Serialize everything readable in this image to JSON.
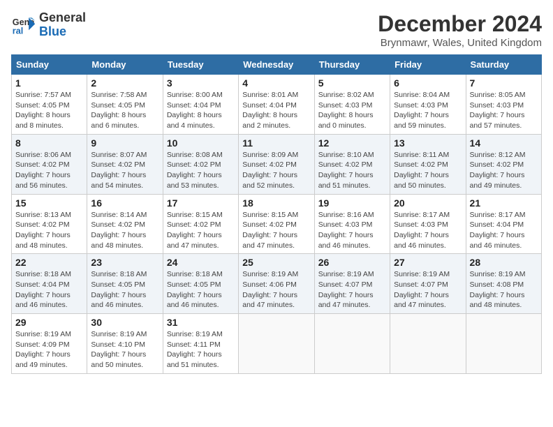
{
  "header": {
    "logo_line1": "General",
    "logo_line2": "Blue",
    "month_title": "December 2024",
    "location": "Brynmawr, Wales, United Kingdom"
  },
  "weekdays": [
    "Sunday",
    "Monday",
    "Tuesday",
    "Wednesday",
    "Thursday",
    "Friday",
    "Saturday"
  ],
  "weeks": [
    [
      {
        "day": "1",
        "info": "Sunrise: 7:57 AM\nSunset: 4:05 PM\nDaylight: 8 hours and 8 minutes."
      },
      {
        "day": "2",
        "info": "Sunrise: 7:58 AM\nSunset: 4:05 PM\nDaylight: 8 hours and 6 minutes."
      },
      {
        "day": "3",
        "info": "Sunrise: 8:00 AM\nSunset: 4:04 PM\nDaylight: 8 hours and 4 minutes."
      },
      {
        "day": "4",
        "info": "Sunrise: 8:01 AM\nSunset: 4:04 PM\nDaylight: 8 hours and 2 minutes."
      },
      {
        "day": "5",
        "info": "Sunrise: 8:02 AM\nSunset: 4:03 PM\nDaylight: 8 hours and 0 minutes."
      },
      {
        "day": "6",
        "info": "Sunrise: 8:04 AM\nSunset: 4:03 PM\nDaylight: 7 hours and 59 minutes."
      },
      {
        "day": "7",
        "info": "Sunrise: 8:05 AM\nSunset: 4:03 PM\nDaylight: 7 hours and 57 minutes."
      }
    ],
    [
      {
        "day": "8",
        "info": "Sunrise: 8:06 AM\nSunset: 4:02 PM\nDaylight: 7 hours and 56 minutes."
      },
      {
        "day": "9",
        "info": "Sunrise: 8:07 AM\nSunset: 4:02 PM\nDaylight: 7 hours and 54 minutes."
      },
      {
        "day": "10",
        "info": "Sunrise: 8:08 AM\nSunset: 4:02 PM\nDaylight: 7 hours and 53 minutes."
      },
      {
        "day": "11",
        "info": "Sunrise: 8:09 AM\nSunset: 4:02 PM\nDaylight: 7 hours and 52 minutes."
      },
      {
        "day": "12",
        "info": "Sunrise: 8:10 AM\nSunset: 4:02 PM\nDaylight: 7 hours and 51 minutes."
      },
      {
        "day": "13",
        "info": "Sunrise: 8:11 AM\nSunset: 4:02 PM\nDaylight: 7 hours and 50 minutes."
      },
      {
        "day": "14",
        "info": "Sunrise: 8:12 AM\nSunset: 4:02 PM\nDaylight: 7 hours and 49 minutes."
      }
    ],
    [
      {
        "day": "15",
        "info": "Sunrise: 8:13 AM\nSunset: 4:02 PM\nDaylight: 7 hours and 48 minutes."
      },
      {
        "day": "16",
        "info": "Sunrise: 8:14 AM\nSunset: 4:02 PM\nDaylight: 7 hours and 48 minutes."
      },
      {
        "day": "17",
        "info": "Sunrise: 8:15 AM\nSunset: 4:02 PM\nDaylight: 7 hours and 47 minutes."
      },
      {
        "day": "18",
        "info": "Sunrise: 8:15 AM\nSunset: 4:02 PM\nDaylight: 7 hours and 47 minutes."
      },
      {
        "day": "19",
        "info": "Sunrise: 8:16 AM\nSunset: 4:03 PM\nDaylight: 7 hours and 46 minutes."
      },
      {
        "day": "20",
        "info": "Sunrise: 8:17 AM\nSunset: 4:03 PM\nDaylight: 7 hours and 46 minutes."
      },
      {
        "day": "21",
        "info": "Sunrise: 8:17 AM\nSunset: 4:04 PM\nDaylight: 7 hours and 46 minutes."
      }
    ],
    [
      {
        "day": "22",
        "info": "Sunrise: 8:18 AM\nSunset: 4:04 PM\nDaylight: 7 hours and 46 minutes."
      },
      {
        "day": "23",
        "info": "Sunrise: 8:18 AM\nSunset: 4:05 PM\nDaylight: 7 hours and 46 minutes."
      },
      {
        "day": "24",
        "info": "Sunrise: 8:18 AM\nSunset: 4:05 PM\nDaylight: 7 hours and 46 minutes."
      },
      {
        "day": "25",
        "info": "Sunrise: 8:19 AM\nSunset: 4:06 PM\nDaylight: 7 hours and 47 minutes."
      },
      {
        "day": "26",
        "info": "Sunrise: 8:19 AM\nSunset: 4:07 PM\nDaylight: 7 hours and 47 minutes."
      },
      {
        "day": "27",
        "info": "Sunrise: 8:19 AM\nSunset: 4:07 PM\nDaylight: 7 hours and 47 minutes."
      },
      {
        "day": "28",
        "info": "Sunrise: 8:19 AM\nSunset: 4:08 PM\nDaylight: 7 hours and 48 minutes."
      }
    ],
    [
      {
        "day": "29",
        "info": "Sunrise: 8:19 AM\nSunset: 4:09 PM\nDaylight: 7 hours and 49 minutes."
      },
      {
        "day": "30",
        "info": "Sunrise: 8:19 AM\nSunset: 4:10 PM\nDaylight: 7 hours and 50 minutes."
      },
      {
        "day": "31",
        "info": "Sunrise: 8:19 AM\nSunset: 4:11 PM\nDaylight: 7 hours and 51 minutes."
      },
      null,
      null,
      null,
      null
    ]
  ]
}
